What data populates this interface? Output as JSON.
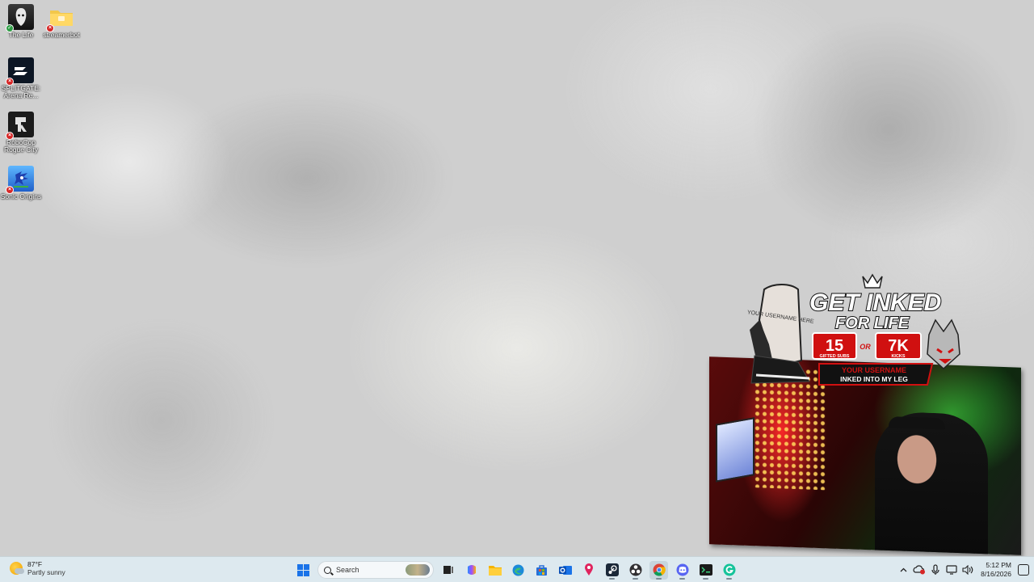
{
  "desktop": {
    "icons": [
      {
        "label": "The Life",
        "icon": "game-icon-the-life",
        "status": "synced"
      },
      {
        "label": "streamerbot",
        "icon": "folder-icon",
        "status": "error"
      },
      {
        "label": "SPLITGATE: Arena Re...",
        "icon": "splitgate-icon",
        "status": "error"
      },
      {
        "label": "RoboCop Rogue City",
        "icon": "robocop-icon",
        "status": "error"
      },
      {
        "label": "Sonic Origins",
        "icon": "sonic-icon",
        "status": "error"
      }
    ]
  },
  "overlay": {
    "promo_line1": "GET INKED",
    "promo_line2": "FOR LIFE",
    "option_a_value": "15",
    "option_a_label": "GIFTED SUBS",
    "or_word": "OR",
    "option_b_value": "7K",
    "option_b_label": "KICKS",
    "banner_line1": "YOUR USERNAME",
    "banner_line2": "INKED INTO MY LEG",
    "leg_text": "YOUR USERNAME HERE"
  },
  "taskbar": {
    "weather": {
      "temp": "87°F",
      "condition": "Partly sunny"
    },
    "search_placeholder": "Search",
    "apps": [
      "start-icon",
      "search",
      "task-view-icon",
      "copilot-icon",
      "file-explorer-icon",
      "edge-icon",
      "store-icon",
      "outlook-icon",
      "maps-pin-icon",
      "steam-icon",
      "obs-icon",
      "chrome-icon",
      "discord-icon",
      "terminal-icon",
      "grammarly-icon"
    ],
    "tray": {
      "time": "5:12 PM",
      "date": "8/16/2026"
    }
  },
  "colors": {
    "taskbar_bg": "#dde9ef",
    "accent": "#1a73e8",
    "error_badge": "#d62626",
    "ok_badge": "#2e9e44",
    "promo_red": "#d01010"
  }
}
